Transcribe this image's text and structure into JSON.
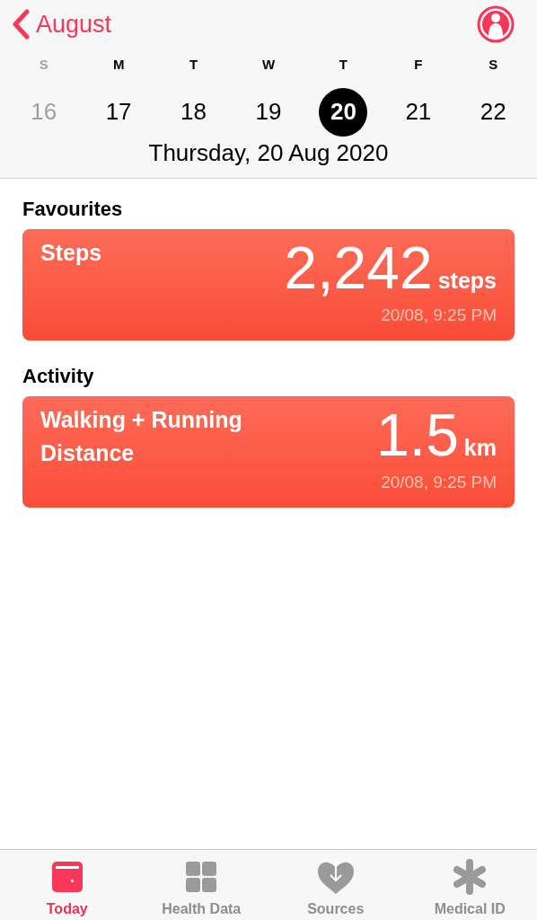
{
  "header": {
    "back_label": "August"
  },
  "week": [
    {
      "letter": "S",
      "day": "16",
      "selected": false,
      "dimmed": true
    },
    {
      "letter": "M",
      "day": "17",
      "selected": false,
      "dimmed": false
    },
    {
      "letter": "T",
      "day": "18",
      "selected": false,
      "dimmed": false
    },
    {
      "letter": "W",
      "day": "19",
      "selected": false,
      "dimmed": false
    },
    {
      "letter": "T",
      "day": "20",
      "selected": true,
      "dimmed": false
    },
    {
      "letter": "F",
      "day": "21",
      "selected": false,
      "dimmed": false
    },
    {
      "letter": "S",
      "day": "22",
      "selected": false,
      "dimmed": false
    }
  ],
  "date_label": "Thursday, 20 Aug 2020",
  "sections": [
    {
      "title": "Favourites",
      "card": {
        "title": "Steps",
        "value": "2,242",
        "unit": "steps",
        "time": "20/08, 9:25 PM"
      }
    },
    {
      "title": "Activity",
      "card": {
        "title": "Walking + Running Distance",
        "value": "1.5",
        "unit": "km",
        "time": "20/08, 9:25 PM"
      }
    }
  ],
  "tab_bar": [
    {
      "label": "Today",
      "selected": true
    },
    {
      "label": "Health Data",
      "selected": false
    },
    {
      "label": "Sources",
      "selected": false
    },
    {
      "label": "Medical ID",
      "selected": false
    }
  ]
}
